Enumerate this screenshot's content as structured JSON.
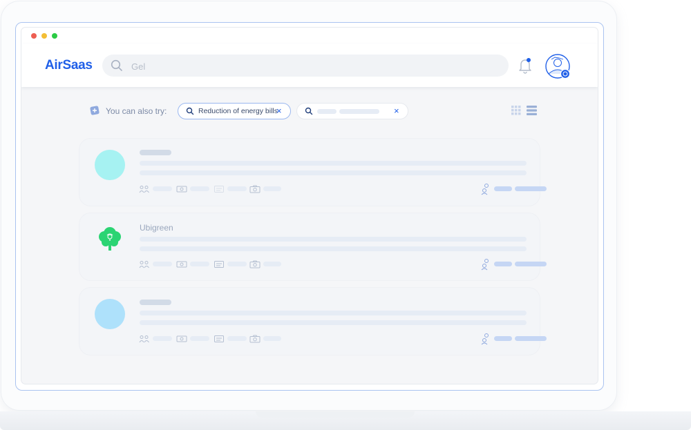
{
  "header": {
    "logo": "AirSaas",
    "search": {
      "value": "Gel",
      "placeholder": ""
    }
  },
  "suggestions": {
    "label": "You can also try:",
    "chips": [
      {
        "text": "Reduction of energy bills",
        "close": "×"
      },
      {
        "text": "",
        "close": "×"
      }
    ]
  },
  "cards": [
    {
      "name": "",
      "logo_color": "#a6f2f2"
    },
    {
      "name": "Ubigreen",
      "logo_color": "#2bd473"
    },
    {
      "name": "",
      "logo_color": "#aee1fb"
    }
  ],
  "colors": {
    "brand": "#1f5fe8",
    "placeholder_bar": "#e6ecf5",
    "accent_bar": "#c5d6f4"
  },
  "icons": [
    "search-icon",
    "bell-icon",
    "avatar-icon",
    "grid-view-icon",
    "list-view-icon",
    "people-icon",
    "tree-icon"
  ]
}
